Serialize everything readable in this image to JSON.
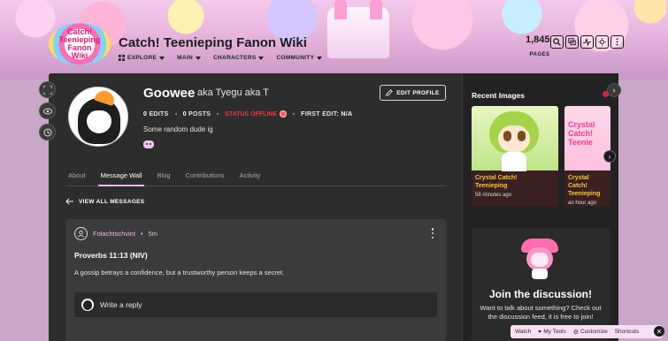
{
  "wiki": {
    "title": "Catch! Teenieping Fanon Wiki",
    "logo_text": [
      "Catch!",
      "Teenieping",
      "Fanon",
      "Wiki"
    ],
    "nav": [
      {
        "label": "EXPLORE"
      },
      {
        "label": "MAIN"
      },
      {
        "label": "CHARACTERS"
      },
      {
        "label": "COMMUNITY"
      }
    ],
    "pages_count": "1,845",
    "pages_label": "PAGES",
    "tool_icons": [
      "search-icon",
      "discussions-icon",
      "activity-icon",
      "theme-toggle-icon",
      "more-icon"
    ]
  },
  "profile": {
    "username": "Goowee",
    "aka": "aka Tyegu aka T",
    "edit_button": "EDIT PROFILE",
    "stats": {
      "edits": "0",
      "edits_label": "EDITS",
      "posts": "0",
      "posts_label": "POSTS",
      "status": "STATUS OFFLINE",
      "first_edit_label": "FIRST EDIT:",
      "first_edit_value": "N/A"
    },
    "bio": "Some random dude ig",
    "social_icon": "discord-icon"
  },
  "tabs": [
    {
      "label": "About",
      "active": false
    },
    {
      "label": "Message Wall",
      "active": true
    },
    {
      "label": "Blog",
      "active": false
    },
    {
      "label": "Contributions",
      "active": false
    },
    {
      "label": "Activity",
      "active": false
    }
  ],
  "wall": {
    "view_all": "VIEW ALL MESSAGES",
    "message": {
      "author": "Folachtschvint",
      "separator": "•",
      "time": "5m",
      "title": "Proverbs 11:13 (NIV)",
      "body": "A gossip betrays a confidence, but a trustworthy person keeps a secret.",
      "reply_placeholder": "Write a reply"
    }
  },
  "rail": {
    "recent_images_title": "Recent Images",
    "images": [
      {
        "title": "Crystal Catch!\nTeenieping",
        "time": "58 minutes ago"
      },
      {
        "title": "Crystal Catch!\nTeenieping",
        "time": "an hour ago"
      }
    ],
    "thumb_text": "Crystal Catch! Teenie",
    "discussion": {
      "title": "Join the discussion!",
      "text": "Want to talk about something? Check out the discussion feed, it is free to join!"
    }
  },
  "toolbar": {
    "watch": "Watch",
    "my_tools": "My Tools",
    "customize": "Customize",
    "shortcuts": "Shortcuts"
  }
}
